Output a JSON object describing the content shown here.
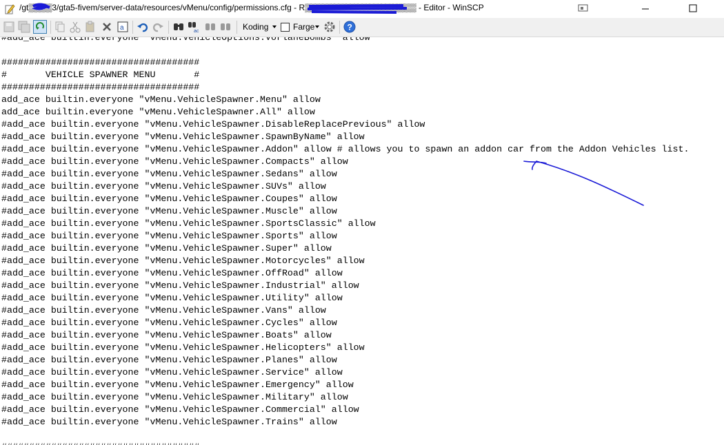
{
  "window": {
    "title": "/gt▒▒▒▒3/gta5-fivem/server-data/resources/vMenu/config/permissions.cfg - R▒▒▒▒▒▒▒▒▒▒▒▒▒▒▒▒▒▒▒ - Editor - WinSCP",
    "icons": [
      "edit-file-icon",
      "restore-icon",
      "minimize-icon",
      "maximize-icon"
    ]
  },
  "toolbar": {
    "encoding_label": "Koding",
    "color_label": "Farge",
    "color_checked": false,
    "icons": [
      "save-icon",
      "save-all-icon",
      "reload-icon",
      "copy-icon",
      "cut-icon",
      "paste-icon",
      "delete-icon",
      "select-all-icon",
      "undo-icon",
      "redo-icon",
      "find-icon",
      "replace-icon",
      "find-next-icon",
      "settings-icon",
      "help-icon"
    ]
  },
  "editor": {
    "lines": [
      "#add_ace builtin.everyone \"vMenu.VehicleOptions.VorlaneBombs\" allow",
      "",
      "####################################",
      "#       VEHICLE SPAWNER MENU       #",
      "####################################",
      "add_ace builtin.everyone \"vMenu.VehicleSpawner.Menu\" allow",
      "add_ace builtin.everyone \"vMenu.VehicleSpawner.All\" allow",
      "#add_ace builtin.everyone \"vMenu.VehicleSpawner.DisableReplacePrevious\" allow",
      "#add_ace builtin.everyone \"vMenu.VehicleSpawner.SpawnByName\" allow",
      "#add_ace builtin.everyone \"vMenu.VehicleSpawner.Addon\" allow # allows you to spawn an addon car from the Addon Vehicles list.",
      "#add_ace builtin.everyone \"vMenu.VehicleSpawner.Compacts\" allow",
      "#add_ace builtin.everyone \"vMenu.VehicleSpawner.Sedans\" allow",
      "#add_ace builtin.everyone \"vMenu.VehicleSpawner.SUVs\" allow",
      "#add_ace builtin.everyone \"vMenu.VehicleSpawner.Coupes\" allow",
      "#add_ace builtin.everyone \"vMenu.VehicleSpawner.Muscle\" allow",
      "#add_ace builtin.everyone \"vMenu.VehicleSpawner.SportsClassic\" allow",
      "#add_ace builtin.everyone \"vMenu.VehicleSpawner.Sports\" allow",
      "#add_ace builtin.everyone \"vMenu.VehicleSpawner.Super\" allow",
      "#add_ace builtin.everyone \"vMenu.VehicleSpawner.Motorcycles\" allow",
      "#add_ace builtin.everyone \"vMenu.VehicleSpawner.OffRoad\" allow",
      "#add_ace builtin.everyone \"vMenu.VehicleSpawner.Industrial\" allow",
      "#add_ace builtin.everyone \"vMenu.VehicleSpawner.Utility\" allow",
      "#add_ace builtin.everyone \"vMenu.VehicleSpawner.Vans\" allow",
      "#add_ace builtin.everyone \"vMenu.VehicleSpawner.Cycles\" allow",
      "#add_ace builtin.everyone \"vMenu.VehicleSpawner.Boats\" allow",
      "#add_ace builtin.everyone \"vMenu.VehicleSpawner.Helicopters\" allow",
      "#add_ace builtin.everyone \"vMenu.VehicleSpawner.Planes\" allow",
      "#add_ace builtin.everyone \"vMenu.VehicleSpawner.Service\" allow",
      "#add_ace builtin.everyone \"vMenu.VehicleSpawner.Emergency\" allow",
      "#add_ace builtin.everyone \"vMenu.VehicleSpawner.Military\" allow",
      "#add_ace builtin.everyone \"vMenu.VehicleSpawner.Commercial\" allow",
      "#add_ace builtin.everyone \"vMenu.VehicleSpawner.Trains\" allow",
      "",
      "####################################"
    ]
  },
  "colors": {
    "annotation_ink": "#1a1ad6",
    "toolbar_bg": "#f0f0f0",
    "help_blue": "#2f6fd8"
  }
}
